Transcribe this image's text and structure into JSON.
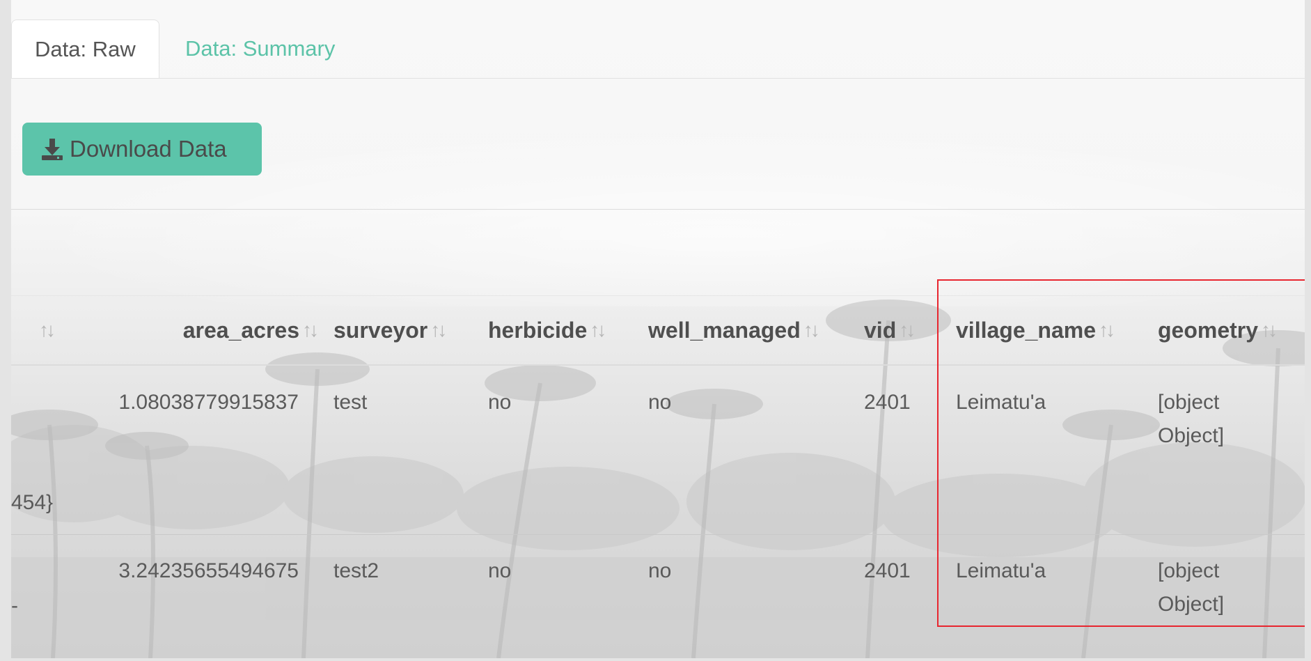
{
  "tabs": [
    {
      "label": "Data: Raw",
      "active": true
    },
    {
      "label": "Data: Summary",
      "active": false
    }
  ],
  "download_button": {
    "label": "Download Data",
    "icon": "download-icon"
  },
  "colors": {
    "accent": "#5cc4aa",
    "tab_link": "#5cc3a8",
    "highlight_border": "#e8262f"
  },
  "table": {
    "columns": [
      {
        "key": "truncated",
        "label": ""
      },
      {
        "key": "area_acres",
        "label": "area_acres"
      },
      {
        "key": "surveyor",
        "label": "surveyor"
      },
      {
        "key": "herbicide",
        "label": "herbicide"
      },
      {
        "key": "well_managed",
        "label": "well_managed"
      },
      {
        "key": "vid",
        "label": "vid"
      },
      {
        "key": "village_name",
        "label": "village_name"
      },
      {
        "key": "geometry",
        "label": "geometry"
      }
    ],
    "sort_icon": "sort-icon",
    "rows": [
      {
        "truncated": "454}",
        "area_acres": "1.08038779915837",
        "surveyor": "test",
        "herbicide": "no",
        "well_managed": "no",
        "vid": "2401",
        "village_name": "Leimatu'a",
        "geometry_line1": "[object",
        "geometry_line2": "Object]"
      },
      {
        "truncated": "-",
        "area_acres": "3.24235655494675",
        "surveyor": "test2",
        "herbicide": "no",
        "well_managed": "no",
        "vid": "2401",
        "village_name": "Leimatu'a",
        "geometry_line1": "[object",
        "geometry_line2": "Object]"
      }
    ]
  }
}
